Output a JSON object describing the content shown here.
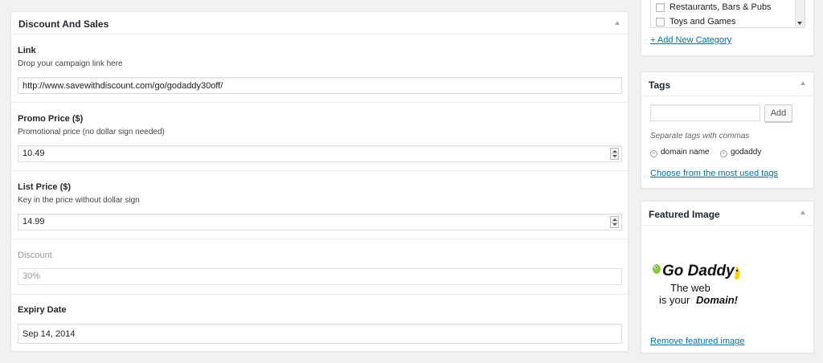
{
  "main": {
    "title": "Discount And Sales",
    "fields": [
      {
        "label": "Link",
        "description": "Drop your campaign link here",
        "value": "http://www.savewithdiscount.com/go/godaddy30off/"
      },
      {
        "label": "Promo Price ($)",
        "description": "Promotional price (no dollar sign needed)",
        "value": "10.49"
      },
      {
        "label": "List Price ($)",
        "description": "Key in the price without dollar sign",
        "value": "14.99"
      },
      {
        "label": "Discount",
        "value": "30%"
      },
      {
        "label": "Expiry Date",
        "value": "Sep 14, 2014"
      }
    ]
  },
  "categories": {
    "items": [
      {
        "label": "Restaurants, Bars & Pubs",
        "checked": false
      },
      {
        "label": "Toys and Games",
        "checked": false
      }
    ],
    "add_link": "+ Add New Category"
  },
  "tags": {
    "title": "Tags",
    "input_value": "",
    "add_button": "Add",
    "hint": "Separate tags with commas",
    "items": [
      "domain name",
      "godaddy"
    ],
    "most_used_link": "Choose from the most used tags"
  },
  "featured": {
    "title": "Featured Image",
    "logo_text": [
      "Go Daddy",
      "The web",
      "is your",
      "Domain!"
    ],
    "remove_link": "Remove featured image"
  },
  "colors": {
    "link": "#0073aa",
    "logo_green": "#8dc63f",
    "logo_yellow": "#f5d10c"
  }
}
